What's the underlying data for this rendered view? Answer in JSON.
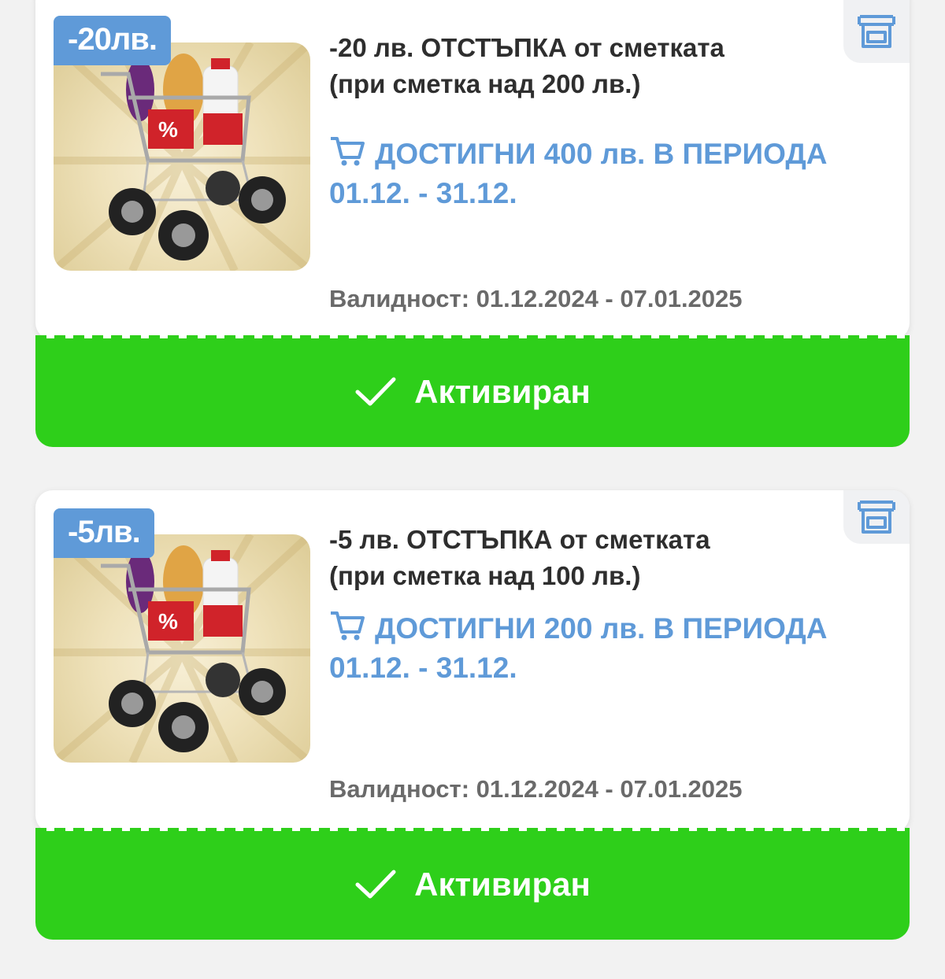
{
  "coupons": [
    {
      "badge": "-20лв.",
      "title_line1": "-20 лв. ОТСТЪПКА от сметката",
      "title_line2": "(при сметка над 200 лв.)",
      "promo_line1": "ДОСТИГНИ 400 лв. В ПЕРИОДА",
      "promo_line2": "01.12. - 31.12.",
      "validity": "Валидност: 01.12.2024 - 07.01.2025",
      "action_label": "Активиран",
      "store_icon": "store-icon",
      "image": "shopping-cart-discount-image"
    },
    {
      "badge": "-5лв.",
      "title_line1": "-5 лв. ОТСТЪПКА от сметката",
      "title_line2": "(при сметка над 100 лв.)",
      "promo_line1": "ДОСТИГНИ 200 лв. В ПЕРИОДА",
      "promo_line2": "01.12. - 31.12.",
      "validity": "Валидност: 01.12.2024 - 07.01.2025",
      "action_label": "Активиран",
      "store_icon": "store-icon",
      "image": "shopping-cart-discount-image"
    }
  ],
  "colors": {
    "accent_blue": "#5f9ad8",
    "activated_green": "#2ecf1a",
    "card_bg": "#ffffff",
    "page_bg": "#f2f2f2"
  }
}
